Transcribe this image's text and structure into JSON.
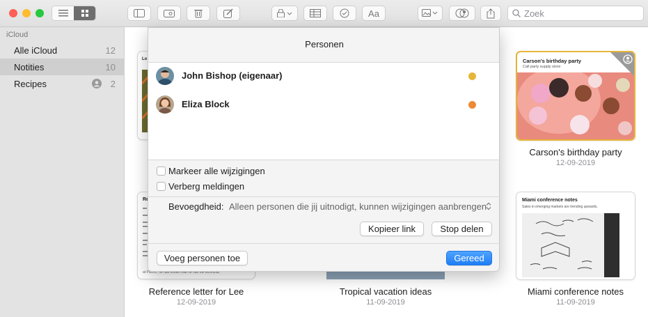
{
  "toolbar": {
    "search_placeholder": "Zoek",
    "aa_label": "Aa"
  },
  "sidebar": {
    "section": "iCloud",
    "items": [
      {
        "label": "Alle iCloud",
        "count": "12"
      },
      {
        "label": "Notities",
        "count": "10"
      },
      {
        "label": "Recipes",
        "count": "2"
      }
    ]
  },
  "notes": [
    {
      "title": "Carson's birthday party",
      "date": "12-09-2019",
      "preview_title": "Carson's birthday party",
      "preview_sub": "Call party supply store"
    },
    {
      "title": "Reference letter for Lee",
      "date": "12-09-2019",
      "preview_title": "Re",
      "preview_tail": "at Pacific, he has shown that he has the technical,"
    },
    {
      "title": "Tropical vacation ideas",
      "date": "11-09-2019"
    },
    {
      "title": "Miami conference notes",
      "date": "11-09-2019",
      "preview_title": "Miami conference notes",
      "preview_sub": "Sales in emerging markets are trending upwards."
    }
  ],
  "popover": {
    "title": "Personen",
    "people": [
      {
        "name": "John Bishop (eigenaar)",
        "color": "#e6b63a"
      },
      {
        "name": "Eliza Block",
        "color": "#ef8a35"
      }
    ],
    "options": {
      "mark_changes": "Markeer alle wijzigingen",
      "hide_alerts": "Verberg meldingen"
    },
    "permission": {
      "label": "Bevoegdheid:",
      "value": "Alleen personen die jij uitnodigt, kunnen wijzigingen aanbrengen"
    },
    "buttons": {
      "copy_link": "Kopieer link",
      "stop_sharing": "Stop delen",
      "add_people": "Voeg personen toe",
      "done": "Gereed"
    }
  },
  "colors": {
    "accent": "#1f7ef5",
    "selected_card": "#e6b63a"
  }
}
